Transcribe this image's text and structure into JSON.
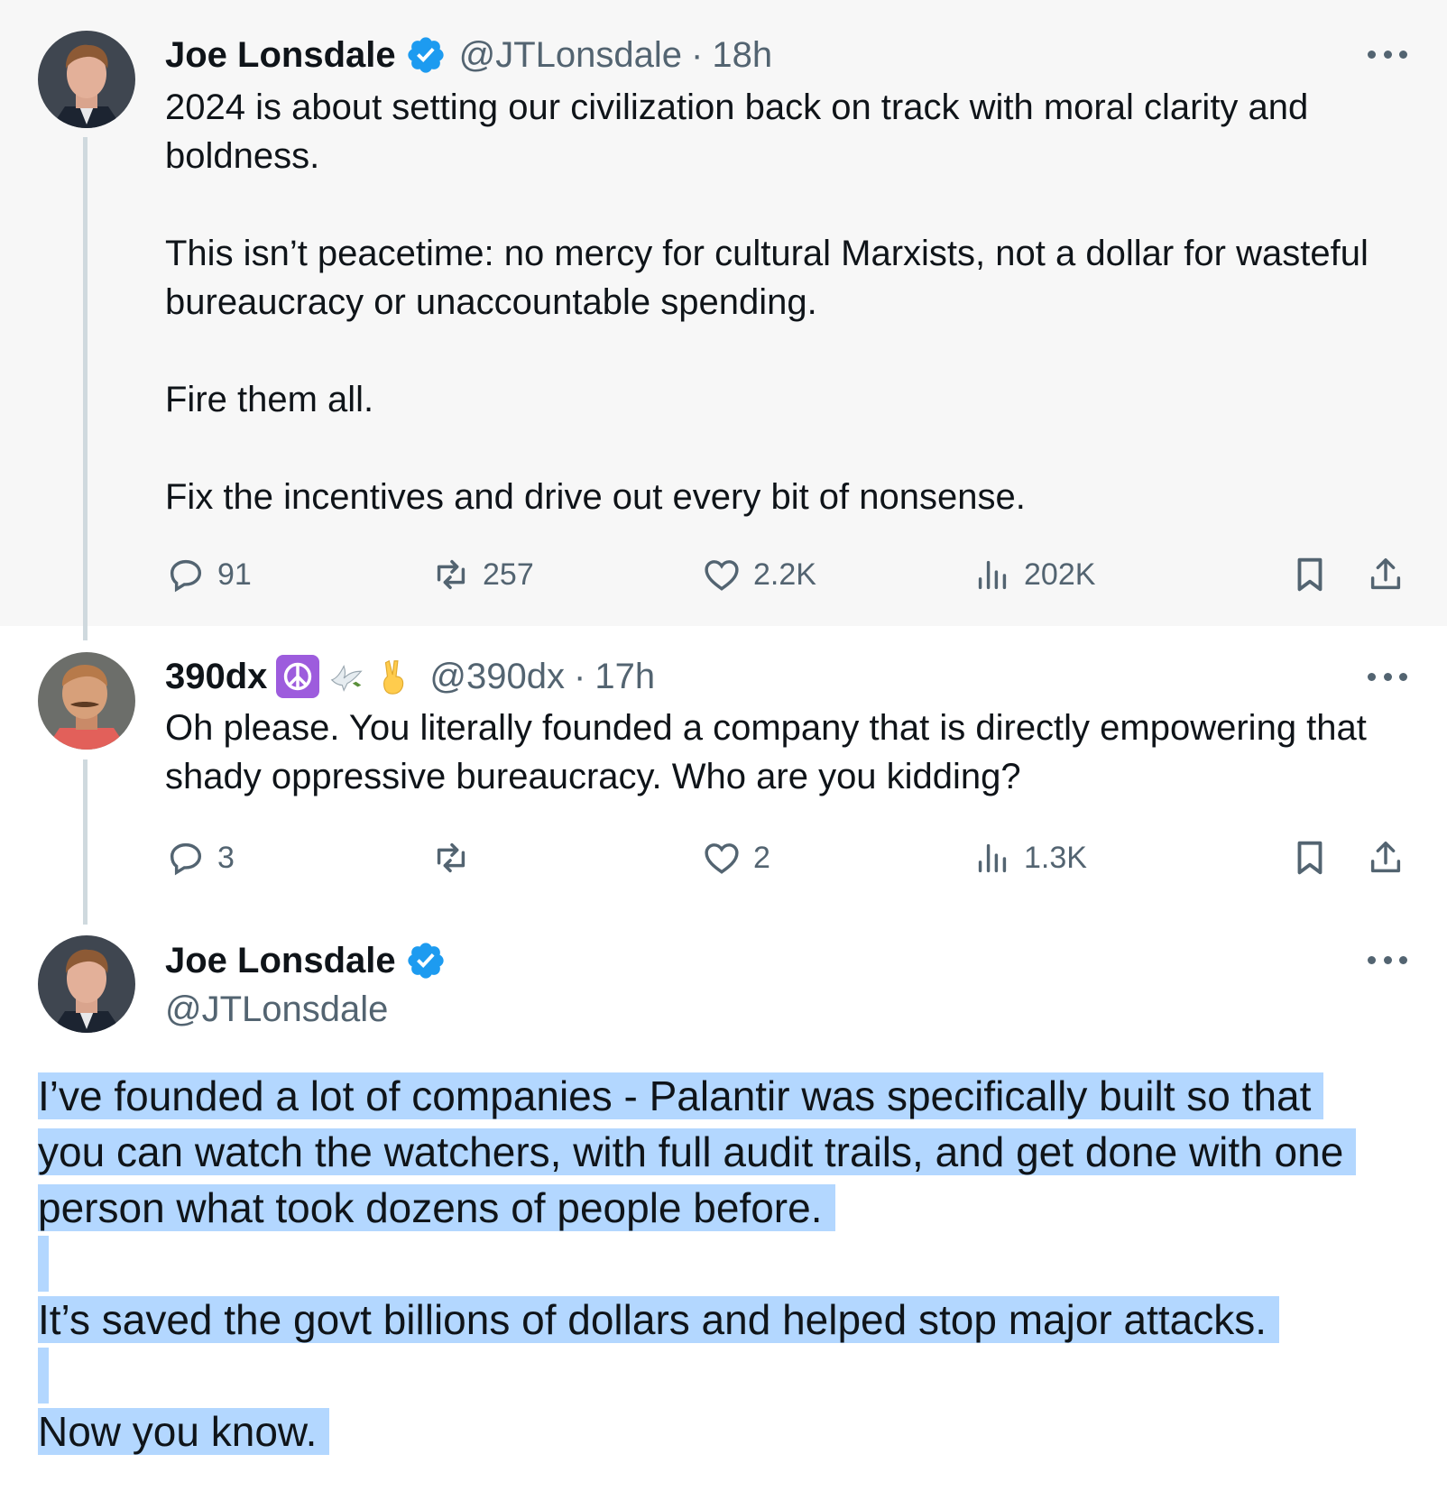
{
  "tweets": [
    {
      "name": "Joe Lonsdale",
      "handle": "@JTLonsdale",
      "separator": "·",
      "time": "18h",
      "paragraphs": [
        "2024 is about setting our civilization back on track with moral clarity and boldness.",
        "This isn’t peacetime: no mercy for cultural Marxists, not a dollar for wasteful bureaucracy or unaccountable spending.",
        "Fire them all.",
        "Fix the incentives and drive out every bit of nonsense."
      ],
      "stats": {
        "replies": "91",
        "retweets": "257",
        "likes": "2.2K",
        "views": "202K"
      }
    },
    {
      "name": "390dx",
      "handle": "@390dx",
      "separator": "·",
      "time": "17h",
      "name_emojis": [
        "peace-symbol-emoji",
        "dove-emoji",
        "victory-hand-emoji"
      ],
      "paragraphs": [
        "Oh please. You literally founded a company that is directly empowering that shady oppressive bureaucracy. Who are you kidding?"
      ],
      "stats": {
        "replies": "3",
        "retweets": "",
        "likes": "2",
        "views": "1.3K"
      }
    },
    {
      "name": "Joe Lonsdale",
      "handle": "@JTLonsdale",
      "lines": [
        "I’ve founded a lot of companies - Palantir was specifically built so that",
        "you can watch the watchers, with full audit trails, and get done with one",
        "person what took dozens of people before.",
        "It’s saved the govt billions of dollars and helped stop major attacks.",
        "Now you know."
      ],
      "selection_color": "#b3d7ff"
    }
  ],
  "colors": {
    "highlighted_tweet_bg": "#f7f7f7",
    "secondary_text": "#536471",
    "verified_badge": "#1d9bf0",
    "thread_line": "#cfd9de"
  }
}
